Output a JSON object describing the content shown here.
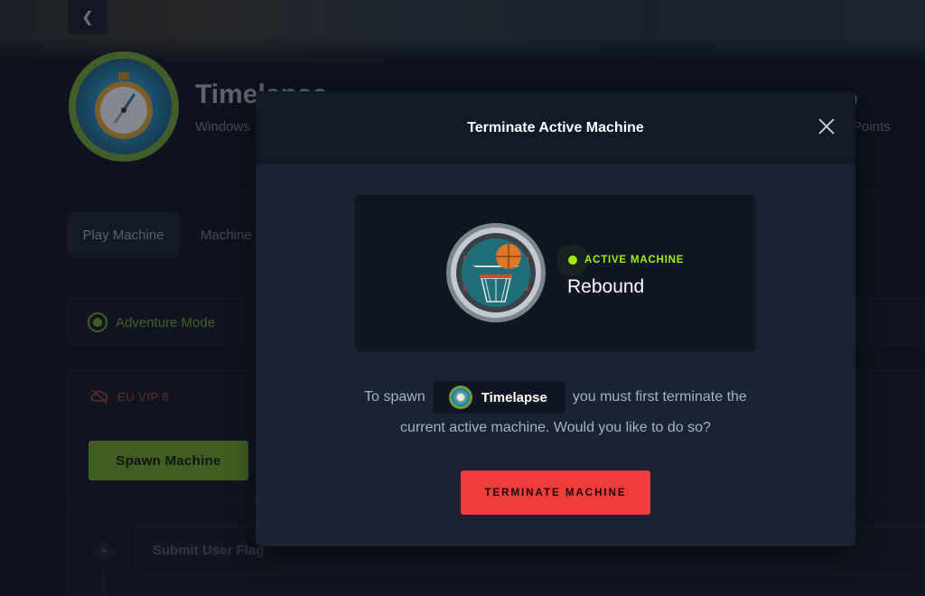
{
  "background": {
    "back_icon": "chevron-left-icon",
    "machine": {
      "title": "Timelapse",
      "os": "Windows",
      "points_label": "Points",
      "points_value": "0"
    },
    "tabs": [
      {
        "label": "Play Machine"
      },
      {
        "label": "Machine"
      }
    ],
    "mode": {
      "label": "Adventure Mode"
    },
    "server": {
      "label": "EU VIP 8",
      "icon": "no-cloud-icon"
    },
    "spawn_button": "Spawn Machine",
    "flag_input_placeholder": "Submit User Flag"
  },
  "modal": {
    "title": "Terminate Active Machine",
    "close_icon": "close-icon",
    "active": {
      "status_label": "ACTIVE MACHINE",
      "name": "Rebound"
    },
    "message": {
      "prefix": "To spawn",
      "target_machine": "Timelapse",
      "suffix": "you must first terminate the",
      "line2": "current active machine. Would you like to do so?"
    },
    "terminate_button": "TERMINATE MACHINE"
  },
  "colors": {
    "accent_green": "#9fef00",
    "spawn_green": "#6aa02a",
    "danger_red": "#ef3d3d",
    "background": "#111927",
    "modal_bg": "#1a2332"
  }
}
